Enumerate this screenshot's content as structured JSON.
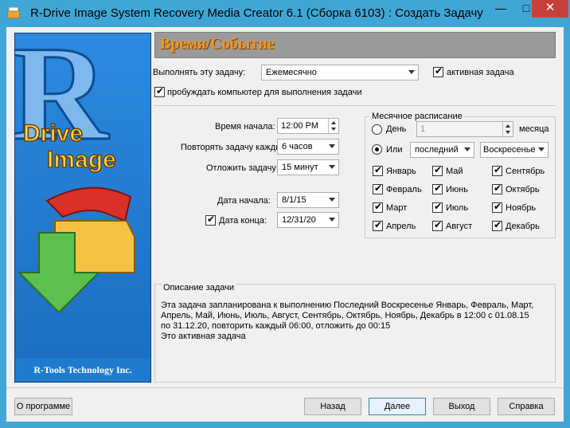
{
  "window": {
    "title": "R-Drive Image System Recovery Media Creator 6.1 (Сборка 6103) : Создать Задачу",
    "minimize_glyph": "—",
    "maximize_glyph": "□",
    "close_glyph": "✕"
  },
  "banner": {
    "logo_text": "Drive Image",
    "footer": "R-Tools Technology Inc."
  },
  "section": {
    "title": "Время/Событие"
  },
  "task": {
    "run_label": "Выполнять эту задачу:",
    "run_value": "Ежемесячно",
    "active_label": "активная задача",
    "active_checked": true,
    "wake_label": "пробуждать компьютер для выполнения задачи",
    "wake_checked": true
  },
  "timing": {
    "start_time_label": "Время начала:",
    "start_time_value": "12:00 PM",
    "repeat_label": "Повторять задачу каждые:",
    "repeat_value": "6 часов",
    "delay_label": "Отложить задачу до:",
    "delay_value": "15  минут",
    "start_date_label": "Дата начала:",
    "start_date_value": "8/1/15",
    "end_date_label": "Дата конца:",
    "end_date_value": "12/31/20",
    "end_date_checked": true
  },
  "monthly": {
    "group_title": "Месячное расписание",
    "day_label": "День",
    "day_value": "1",
    "month_label": "месяца",
    "or_label": "Или",
    "or_selected": true,
    "which_value": "последний",
    "weekday_value": "Воскресенье",
    "months": [
      {
        "label": "Январь",
        "checked": true
      },
      {
        "label": "Май",
        "checked": true
      },
      {
        "label": "Сентябрь",
        "checked": true
      },
      {
        "label": "Февраль",
        "checked": true
      },
      {
        "label": "Июнь",
        "checked": true
      },
      {
        "label": "Октябрь",
        "checked": true
      },
      {
        "label": "Март",
        "checked": true
      },
      {
        "label": "Июль",
        "checked": true
      },
      {
        "label": "Ноябрь",
        "checked": true
      },
      {
        "label": "Апрель",
        "checked": true
      },
      {
        "label": "Август",
        "checked": true
      },
      {
        "label": "Декабрь",
        "checked": true
      }
    ]
  },
  "description": {
    "title": "Описание задачи",
    "text": "Эта задача запланирована к выполнению Последний Воскресенье Январь, Февраль, Март,\nАпрель, Май, Июнь, Июль, Август, Сентябрь, Октябрь, Ноябрь, Декабрь в 12:00 с 01.08.15\nпо 31.12.20, повторить каждый 06:00, отложить до 00:15\nЭто активная задача"
  },
  "buttons": {
    "about": "О программе",
    "back": "Назад",
    "next": "Далее",
    "exit": "Выход",
    "help": "Справка"
  }
}
